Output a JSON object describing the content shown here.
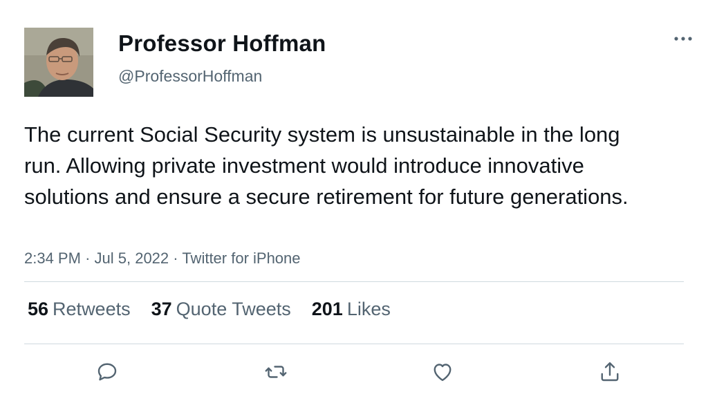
{
  "author": {
    "display_name": "Professor Hoffman",
    "handle": "@ProfessorHoffman",
    "avatar_icon": "profile-photo"
  },
  "tweet": {
    "text": "The current Social Security system is unsustainable in the long run. Allowing private investment would introduce innovative solutions and ensure a secure retirement for future generations.",
    "time": "2:34 PM",
    "separator": "·",
    "date": "Jul 5, 2022",
    "source": "Twitter for iPhone"
  },
  "stats": {
    "retweets_count": "56",
    "retweets_label": "Retweets",
    "quotes_count": "37",
    "quotes_label": "Quote Tweets",
    "likes_count": "201",
    "likes_label": "Likes"
  },
  "actions": {
    "reply_icon": "reply-icon",
    "retweet_icon": "retweet-icon",
    "like_icon": "heart-icon",
    "share_icon": "share-icon",
    "more_icon": "more-icon"
  },
  "colors": {
    "text_primary": "#0f1419",
    "text_secondary": "#536471",
    "divider": "#cfd9de",
    "icon": "#536471"
  }
}
